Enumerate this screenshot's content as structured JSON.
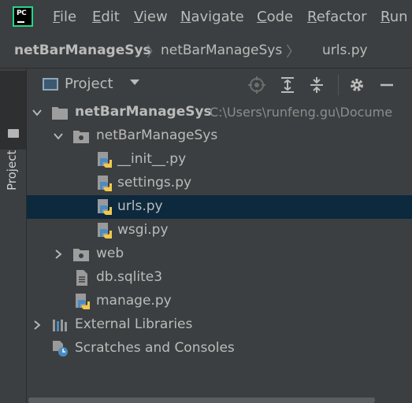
{
  "menu": {
    "items": [
      {
        "label": "File",
        "mnemonic": "F",
        "rest": "ile"
      },
      {
        "label": "Edit",
        "mnemonic": "E",
        "rest": "dit"
      },
      {
        "label": "View",
        "mnemonic": "V",
        "rest": "iew"
      },
      {
        "label": "Navigate",
        "mnemonic": "N",
        "rest": "avigate"
      },
      {
        "label": "Code",
        "mnemonic": "C",
        "rest": "ode"
      },
      {
        "label": "Refactor",
        "mnemonic": "R",
        "rest": "efactor"
      },
      {
        "label": "Run",
        "mnemonic": "R",
        "rest": "un"
      }
    ],
    "logo_text": "PC"
  },
  "breadcrumb": {
    "items": [
      "netBarManageSys",
      "netBarManageSys",
      "urls.py"
    ]
  },
  "stripe": {
    "label": "Project"
  },
  "project_panel": {
    "title": "Project"
  },
  "tree": {
    "root_label": "netBarManageSys",
    "root_path": "C:\\Users\\runfeng.gu\\Docume",
    "package_label": "netBarManageSys",
    "files": [
      "__init__.py",
      "settings.py",
      "urls.py",
      "wsgi.py"
    ],
    "web_label": "web",
    "db_label": "db.sqlite3",
    "manage_label": "manage.py",
    "ext_libs_label": "External Libraries",
    "scratches_label": "Scratches and Consoles"
  },
  "colors": {
    "background": "#3c3f41",
    "selection": "#0d293e",
    "text": "#bbbbbb",
    "python_blue": "#4a8bc2",
    "python_yellow": "#f2c94c",
    "logo_green": "#21d789"
  }
}
